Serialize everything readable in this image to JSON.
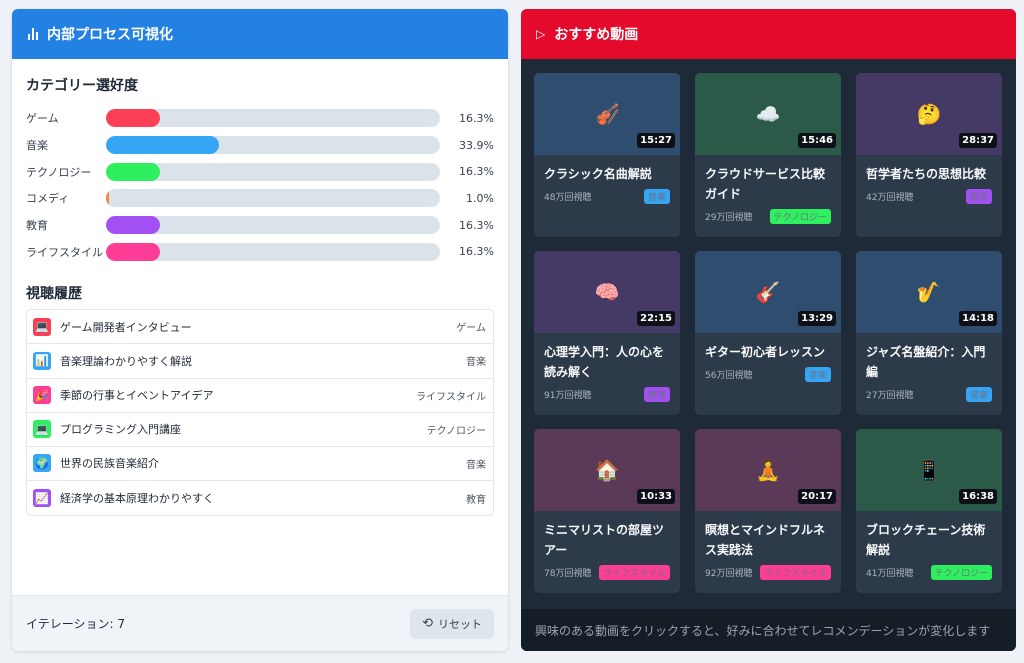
{
  "left": {
    "title": "内部プロセス可視化",
    "icon": "bar-chart-icon",
    "preferences_title": "カテゴリー選好度",
    "preferences": [
      {
        "name": "ゲーム",
        "pct_label": "16.3%",
        "value": 16.3,
        "color": "#fb3f55"
      },
      {
        "name": "音楽",
        "pct_label": "33.9%",
        "value": 33.9,
        "color": "#36a5f4"
      },
      {
        "name": "テクノロジー",
        "pct_label": "16.3%",
        "value": 16.3,
        "color": "#2ef05e"
      },
      {
        "name": "コメディ",
        "pct_label": "1.0%",
        "value": 1.0,
        "color": "#f5873c"
      },
      {
        "name": "教育",
        "pct_label": "16.3%",
        "value": 16.3,
        "color": "#a24ff4"
      },
      {
        "name": "ライフスタイル",
        "pct_label": "16.3%",
        "value": 16.3,
        "color": "#fd3d96"
      }
    ],
    "history_title": "視聴履歴",
    "history": [
      {
        "title": "ゲーム開発者インタビュー",
        "category": "ゲーム",
        "icon": "computer-icon",
        "glyph": "💻",
        "color": "#fb3f55"
      },
      {
        "title": "音楽理論わかりやすく解説",
        "category": "音楽",
        "icon": "chart-icon",
        "glyph": "📊",
        "color": "#36a5f4"
      },
      {
        "title": "季節の行事とイベントアイデア",
        "category": "ライフスタイル",
        "icon": "party-icon",
        "glyph": "🎉",
        "color": "#fd3d96"
      },
      {
        "title": "プログラミング入門講座",
        "category": "テクノロジー",
        "icon": "laptop-icon",
        "glyph": "💻",
        "color": "#2ef05e"
      },
      {
        "title": "世界の民族音楽紹介",
        "category": "音楽",
        "icon": "globe-icon",
        "glyph": "🌍",
        "color": "#36a5f4"
      },
      {
        "title": "経済学の基本原理わかりやすく",
        "category": "教育",
        "icon": "trend-chart-icon",
        "glyph": "📈",
        "color": "#a24ff4"
      }
    ],
    "iteration_label": "イテレーション: 7",
    "reset_label": "リセット",
    "reset_icon": "refresh-icon"
  },
  "right": {
    "title": "おすすめ動画",
    "icon": "play-icon",
    "videos": [
      {
        "title": "クラシック名曲解説",
        "views": "48万回視聴",
        "tag": "音楽",
        "tag_color": "#36a5f4",
        "duration": "15:27",
        "thumb_color": "#2f4d6e",
        "icon": "violin-icon",
        "glyph": "🎻"
      },
      {
        "title": "クラウドサービス比較ガイド",
        "views": "29万回視聴",
        "tag": "テクノロジー",
        "tag_color": "#2ef05e",
        "duration": "15:46",
        "thumb_color": "#2c5a48",
        "icon": "cloud-icon",
        "glyph": "☁️"
      },
      {
        "title": "哲学者たちの思想比較",
        "views": "42万回視聴",
        "tag": "教育",
        "tag_color": "#a24ff4",
        "duration": "28:37",
        "thumb_color": "#453a65",
        "icon": "thinking-face-icon",
        "glyph": "🤔"
      },
      {
        "title": "心理学入門：人の心を読み解く",
        "views": "91万回視聴",
        "tag": "教育",
        "tag_color": "#a24ff4",
        "duration": "22:15",
        "thumb_color": "#453a65",
        "icon": "brain-icon",
        "glyph": "🧠"
      },
      {
        "title": "ギター初心者レッスン",
        "views": "56万回視聴",
        "tag": "音楽",
        "tag_color": "#36a5f4",
        "duration": "13:29",
        "thumb_color": "#2f4d6e",
        "icon": "guitar-icon",
        "glyph": "🎸"
      },
      {
        "title": "ジャズ名盤紹介：入門編",
        "views": "27万回視聴",
        "tag": "音楽",
        "tag_color": "#36a5f4",
        "duration": "14:18",
        "thumb_color": "#2f4d6e",
        "icon": "saxophone-icon",
        "glyph": "🎷"
      },
      {
        "title": "ミニマリストの部屋ツアー",
        "views": "78万回視聴",
        "tag": "ライフスタイル",
        "tag_color": "#fd3d96",
        "duration": "10:33",
        "thumb_color": "#5a3a58",
        "icon": "house-icon",
        "glyph": "🏠"
      },
      {
        "title": "瞑想とマインドフルネス実践法",
        "views": "92万回視聴",
        "tag": "ライフスタイル",
        "tag_color": "#fd3d96",
        "duration": "20:17",
        "thumb_color": "#5a3a58",
        "icon": "meditation-icon",
        "glyph": "🧘"
      },
      {
        "title": "ブロックチェーン技術解説",
        "views": "41万回視聴",
        "tag": "テクノロジー",
        "tag_color": "#2ef05e",
        "duration": "16:38",
        "thumb_color": "#2c5a48",
        "icon": "smartphone-icon",
        "glyph": "📱"
      }
    ],
    "footer_text": "興味のある動画をクリックすると、好みに合わせてレコメンデーションが変化します"
  }
}
